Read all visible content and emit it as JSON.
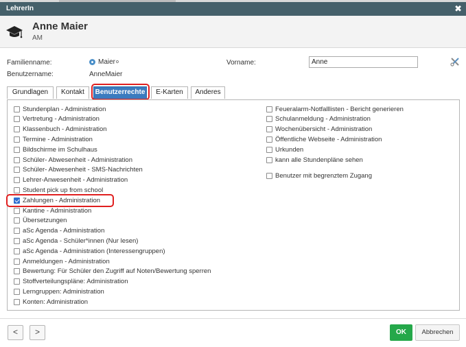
{
  "window": {
    "title": "LehrerIn",
    "close_symbol": "✖"
  },
  "header": {
    "name": "Anne Maier",
    "abbreviation": "AM",
    "icon": "graduation-cap-icon"
  },
  "form": {
    "familienname_label": "Familienname:",
    "familienname_value": "Maier",
    "familienname_marker": "o",
    "vorname_label": "Vorname:",
    "vorname_value": "Anne",
    "benutzername_label": "Benutzername:",
    "benutzername_value": "AnneMaier"
  },
  "tabs": [
    {
      "label": "Grundlagen",
      "active": false
    },
    {
      "label": "Kontakt",
      "active": false
    },
    {
      "label": "Benutzerrechte",
      "active": true
    },
    {
      "label": "E-Karten",
      "active": false
    },
    {
      "label": "Anderes",
      "active": false
    }
  ],
  "permissions_left": [
    {
      "label": "Stundenplan - Administration",
      "checked": false
    },
    {
      "label": "Vertretung - Administration",
      "checked": false
    },
    {
      "label": "Klassenbuch - Administration",
      "checked": false
    },
    {
      "label": "Termine - Administration",
      "checked": false
    },
    {
      "label": "Bildschirme im Schulhaus",
      "checked": false
    },
    {
      "label": "Schüler- Abwesenheit - Administration",
      "checked": false
    },
    {
      "label": "Schüler- Abwesenheit - SMS-Nachrichten",
      "checked": false
    },
    {
      "label": "Lehrer-Anwesenheit - Administration",
      "checked": false
    },
    {
      "label": "Student pick up from school",
      "checked": false
    },
    {
      "label": "Zahlungen - Administration",
      "checked": true
    },
    {
      "label": "Kantine - Administration",
      "checked": false
    },
    {
      "label": "Übersetzungen",
      "checked": false
    },
    {
      "label": "aSc Agenda - Administration",
      "checked": false
    },
    {
      "label": "aSc Agenda - Schüler*innen (Nur lesen)",
      "checked": false
    },
    {
      "label": "aSc Agenda - Administration (Interessengruppen)",
      "checked": false
    },
    {
      "label": "Anmeldungen - Administration",
      "checked": false
    },
    {
      "label": "Bewertung: Für Schüler den Zugriff auf Noten/Bewertung sperren",
      "checked": false
    },
    {
      "label": "Stoffverteilungspläne: Administration",
      "checked": false
    },
    {
      "label": "Lerngruppen: Administration",
      "checked": false
    },
    {
      "label": "Konten: Administration",
      "checked": false
    }
  ],
  "permissions_right": [
    {
      "label": "Feueralarm-Notfalllisten - Bericht generieren",
      "checked": false
    },
    {
      "label": "Schulanmeldung - Administration",
      "checked": false
    },
    {
      "label": "Wochenübersicht - Administration",
      "checked": false
    },
    {
      "label": "Öffentliche Webseite - Administration",
      "checked": false
    },
    {
      "label": "Urkunden",
      "checked": false
    },
    {
      "label": "kann alle Stundenpläne sehen",
      "checked": false
    }
  ],
  "permission_extra": {
    "label": "Benutzer mit begrenztem Zugang",
    "checked": false
  },
  "footer": {
    "prev": "<",
    "next": ">",
    "ok": "OK",
    "cancel": "Abbrechen"
  },
  "colors": {
    "titlebar": "#45606a",
    "active_tab": "#3b7bbf",
    "ok": "#25a84a",
    "highlight": "#e01e1e"
  }
}
